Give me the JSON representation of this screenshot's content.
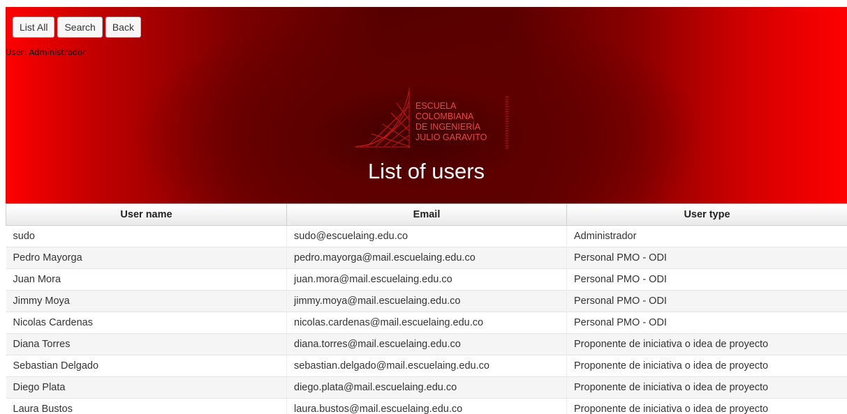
{
  "nav": {
    "buttons": [
      {
        "label": "List All"
      },
      {
        "label": "Search"
      },
      {
        "label": "Back"
      }
    ]
  },
  "user_info": "User: Administrador",
  "logo": {
    "lines": [
      "ESCUELA",
      "COLOMBIANA",
      "DE INGENIERÍA",
      "JULIO GARAVITO"
    ]
  },
  "page_title": "List of users",
  "table": {
    "headers": [
      "User name",
      "Email",
      "User type"
    ],
    "rows": [
      [
        "sudo",
        "sudo@escuelaing.edu.co",
        "Administrador"
      ],
      [
        "Pedro Mayorga",
        "pedro.mayorga@mail.escuelaing.edu.co",
        "Personal PMO - ODI"
      ],
      [
        "Juan Mora",
        "juan.mora@mail.escuelaing.edu.co",
        "Personal PMO - ODI"
      ],
      [
        "Jimmy Moya",
        "jimmy.moya@mail.escuelaing.edu.co",
        "Personal PMO - ODI"
      ],
      [
        "Nicolas Cardenas",
        "nicolas.cardenas@mail.escuelaing.edu.co",
        "Personal PMO - ODI"
      ],
      [
        "Diana Torres",
        "diana.torres@mail.escuelaing.edu.co",
        "Proponente de iniciativa o idea de proyecto"
      ],
      [
        "Sebastian Delgado",
        "sebastian.delgado@mail.escuelaing.edu.co",
        "Proponente de iniciativa o idea de proyecto"
      ],
      [
        "Diego Plata",
        "diego.plata@mail.escuelaing.edu.co",
        "Proponente de iniciativa o idea de proyecto"
      ],
      [
        "Laura Bustos",
        "laura.bustos@mail.escuelaing.edu.co",
        "Proponente de iniciativa o idea de proyecto"
      ]
    ]
  },
  "colors": {
    "banner_edge": "#ff0000",
    "banner_center": "#560000",
    "title_text": "#ffffff",
    "row_alt": "#f5f5f5"
  }
}
